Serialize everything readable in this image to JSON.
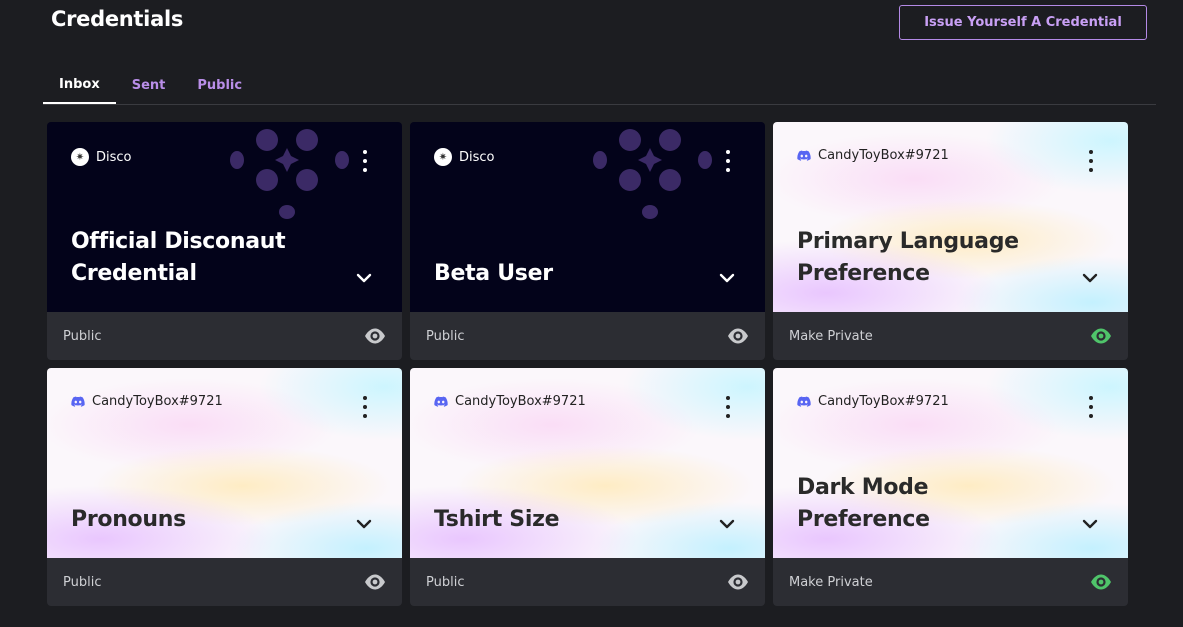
{
  "header": {
    "title": "Credentials",
    "issue_button_label": "Issue Yourself A Credential"
  },
  "tabs": [
    {
      "label": "Inbox",
      "active": true
    },
    {
      "label": "Sent",
      "active": false
    },
    {
      "label": "Public",
      "active": false
    }
  ],
  "cards": [
    {
      "issuer": "Disco",
      "issuer_icon": "disco-logo-icon",
      "theme": "dark",
      "title": "Official Disconaut Credential",
      "visibility_label": "Public",
      "eye_color": "#c8c9cc"
    },
    {
      "issuer": "Disco",
      "issuer_icon": "disco-logo-icon",
      "theme": "dark",
      "title": "Beta User",
      "visibility_label": "Public",
      "eye_color": "#c8c9cc"
    },
    {
      "issuer": "CandyToyBox#9721",
      "issuer_icon": "discord-icon",
      "theme": "light",
      "title": "Primary Language Preference",
      "visibility_label": "Make Private",
      "eye_color": "#4fc46a"
    },
    {
      "issuer": "CandyToyBox#9721",
      "issuer_icon": "discord-icon",
      "theme": "light",
      "title": "Pronouns",
      "visibility_label": "Public",
      "eye_color": "#c8c9cc"
    },
    {
      "issuer": "CandyToyBox#9721",
      "issuer_icon": "discord-icon",
      "theme": "light",
      "title": "Tshirt Size",
      "visibility_label": "Public",
      "eye_color": "#c8c9cc"
    },
    {
      "issuer": "CandyToyBox#9721",
      "issuer_icon": "discord-icon",
      "theme": "light",
      "title": "Dark Mode Preference",
      "visibility_label": "Make Private",
      "eye_color": "#4fc46a"
    }
  ],
  "colors": {
    "accent": "#c9a0f5",
    "discord": "#5865f2",
    "decor_purple": "#3b2a66"
  }
}
